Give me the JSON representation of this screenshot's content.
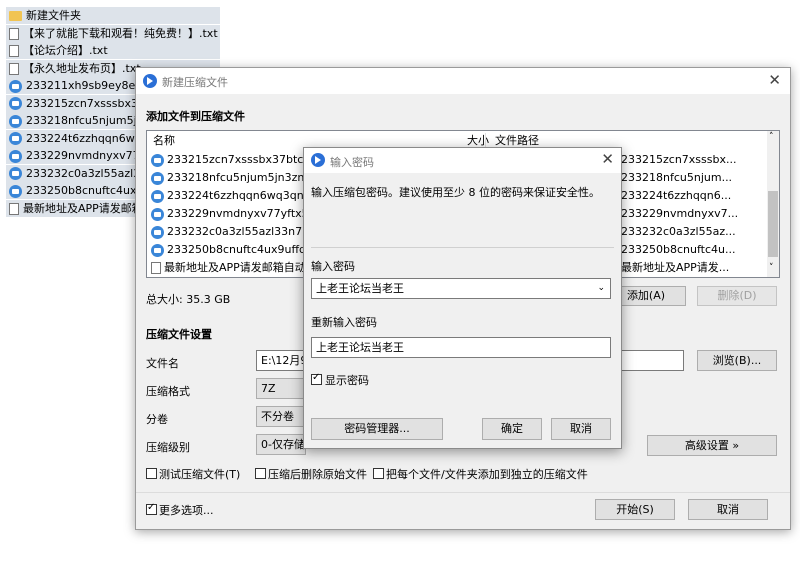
{
  "background_files": [
    {
      "name": "新建文件夹",
      "icon": "folder-icon"
    },
    {
      "name": "【来了就能下载和观看！纯免费！】.txt",
      "icon": "text-file-icon"
    },
    {
      "name": "【论坛介绍】.txt",
      "icon": "text-file-icon"
    },
    {
      "name": "【永久地址发布页】.txt",
      "icon": "text-file-icon"
    },
    {
      "name": "233211xh9sb9ey8eat8k",
      "icon": "gif-file-icon"
    },
    {
      "name": "233215zcn7xsssbx37btc",
      "icon": "gif-file-icon"
    },
    {
      "name": "233218nfcu5njum5jn3zn",
      "icon": "gif-file-icon"
    },
    {
      "name": "233224t6zzhqqn6wq3qq",
      "icon": "gif-file-icon"
    },
    {
      "name": "233229nvmdnyxv77yftx",
      "icon": "gif-file-icon"
    },
    {
      "name": "233232c0a3zl55azl33n7",
      "icon": "gif-file-icon"
    },
    {
      "name": "233250b8cnuftc4ux9uffq",
      "icon": "gif-file-icon"
    },
    {
      "name": "最新地址及APP请发邮箱自",
      "icon": "text-file-icon"
    }
  ],
  "main_dialog": {
    "title": "新建压缩文件",
    "add_section": "添加文件到压缩文件",
    "columns": {
      "name": "名称",
      "size": "大小",
      "path": "文件路径"
    },
    "files": [
      {
        "name": "233215zcn7xsssbx37btcu.gif",
        "path": "233215zcn7xsssbx...",
        "icon": "gif-file-icon"
      },
      {
        "name": "233218nfcu5njum5jn3zn5.gif",
        "path": "233218nfcu5njum...",
        "icon": "gif-file-icon"
      },
      {
        "name": "233224t6zzhqqn6wq3qnyy.gif",
        "path": "233224t6zzhqqn6...",
        "icon": "gif-file-icon"
      },
      {
        "name": "233229nvmdnyxv77yftx54.gif",
        "path": "233229nvmdnyxv7...",
        "icon": "gif-file-icon"
      },
      {
        "name": "233232c0a3zl55azl33n7m.gif",
        "path": "233232c0a3zl55az...",
        "icon": "gif-file-icon"
      },
      {
        "name": "233250b8cnuftc4ux9uffq.gif",
        "path": "233250b8cnuftc4u...",
        "icon": "gif-file-icon"
      },
      {
        "name": "最新地址及APP请发邮箱自动获",
        "path": "最新地址及APP请发...",
        "icon": "text-file-icon"
      }
    ],
    "total_size": "总大小: 35.3 GB",
    "add_button": "添加(A)",
    "delete_button": "删除(D)",
    "settings_section": "压缩文件设置",
    "filename_label": "文件名",
    "filename_value": "E:\\12月9日",
    "browse_button": "浏览(B)...",
    "format_label": "压缩格式",
    "format_value": "7Z",
    "split_label": "分卷",
    "split_value": "不分卷",
    "level_label": "压缩级别",
    "level_value": "0-仅存储",
    "advanced_button": "高级设置 »",
    "test_checkbox": "测试压缩文件(T)",
    "delete_after_checkbox": "压缩后删除原始文件",
    "separate_checkbox": "把每个文件/文件夹添加到独立的压缩文件",
    "more_options": "更多选项...",
    "start_button": "开始(S)",
    "cancel_button": "取消"
  },
  "password_dialog": {
    "title": "输入密码",
    "hint": "输入压缩包密码。建议使用至少 8 位的密码来保证安全性。",
    "password_label": "输入密码",
    "password_value": "上老王论坛当老王",
    "confirm_label": "重新输入密码",
    "confirm_value": "上老王论坛当老王",
    "show_password": "显示密码",
    "manager_button": "密码管理器...",
    "ok_button": "确定",
    "cancel_button": "取消"
  }
}
